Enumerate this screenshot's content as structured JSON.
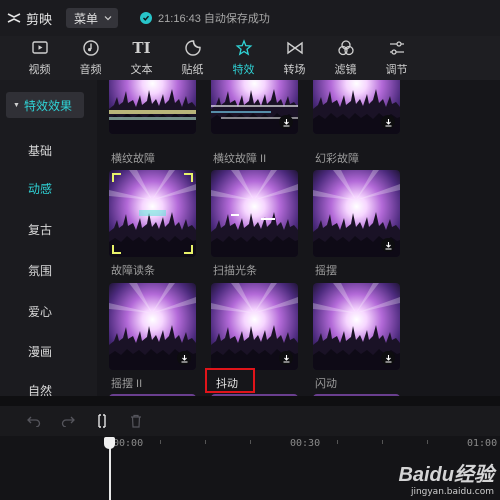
{
  "app": {
    "title": "剪映"
  },
  "titlebar": {
    "menu_label": "菜单",
    "save_status": "21:16:43 自动保存成功"
  },
  "toolbar": {
    "items": [
      {
        "label": "视频",
        "icon": "video-icon"
      },
      {
        "label": "音频",
        "icon": "audio-icon"
      },
      {
        "label": "文本",
        "icon": "text-icon",
        "glyph": "TI"
      },
      {
        "label": "贴纸",
        "icon": "sticker-icon"
      },
      {
        "label": "特效",
        "icon": "effects-icon",
        "active": true
      },
      {
        "label": "转场",
        "icon": "transition-icon"
      },
      {
        "label": "滤镜",
        "icon": "filter-icon"
      },
      {
        "label": "调节",
        "icon": "adjust-icon"
      }
    ]
  },
  "sidebar": {
    "header": "特效效果",
    "items": [
      {
        "label": "基础"
      },
      {
        "label": "动感",
        "active": true
      },
      {
        "label": "复古"
      },
      {
        "label": "氛围"
      },
      {
        "label": "爱心"
      },
      {
        "label": "漫画"
      },
      {
        "label": "自然"
      }
    ]
  },
  "effects": {
    "items": [
      {
        "label": "横纹故障",
        "downloadable": false
      },
      {
        "label": "横纹故障 II",
        "downloadable": true
      },
      {
        "label": "幻彩故障",
        "downloadable": true
      },
      {
        "label": "故障读条",
        "downloadable": false
      },
      {
        "label": "扫描光条",
        "downloadable": false
      },
      {
        "label": "摇摆",
        "downloadable": true
      },
      {
        "label": "摇摆 II",
        "downloadable": true
      },
      {
        "label": "抖动",
        "downloadable": true,
        "highlighted": true
      },
      {
        "label": "闪动",
        "downloadable": true
      }
    ]
  },
  "timeline": {
    "ruler": [
      "00:00",
      "00:30",
      "01:00"
    ]
  },
  "watermark": {
    "brand": "Baidu经验",
    "url": "jingyan.baidu.com"
  },
  "colors": {
    "accent": "#2fd3d6",
    "highlight_box": "#e0141a",
    "background": "#151518"
  }
}
